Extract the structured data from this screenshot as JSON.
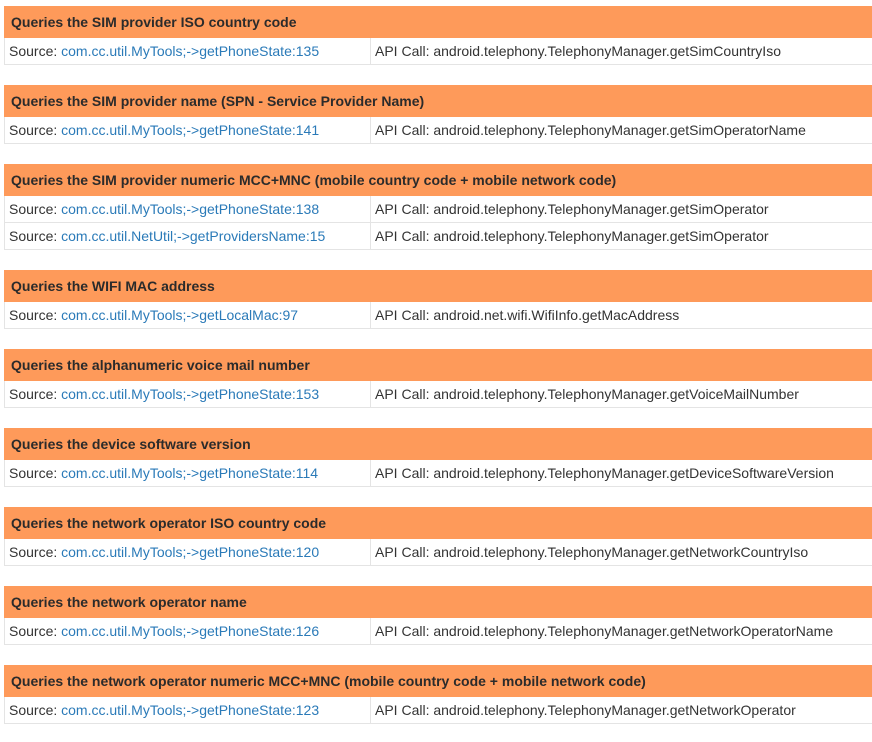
{
  "source_prefix": "Source: ",
  "api_prefix": "API Call: ",
  "sections": [
    {
      "title": "Queries the SIM provider ISO country code",
      "rows": [
        {
          "source": "com.cc.util.MyTools;->getPhoneState:135",
          "api": "android.telephony.TelephonyManager.getSimCountryIso"
        }
      ]
    },
    {
      "title": "Queries the SIM provider name (SPN - Service Provider Name)",
      "rows": [
        {
          "source": "com.cc.util.MyTools;->getPhoneState:141",
          "api": "android.telephony.TelephonyManager.getSimOperatorName"
        }
      ]
    },
    {
      "title": "Queries the SIM provider numeric MCC+MNC (mobile country code + mobile network code)",
      "rows": [
        {
          "source": "com.cc.util.MyTools;->getPhoneState:138",
          "api": "android.telephony.TelephonyManager.getSimOperator"
        },
        {
          "source": "com.cc.util.NetUtil;->getProvidersName:15",
          "api": "android.telephony.TelephonyManager.getSimOperator"
        }
      ]
    },
    {
      "title": "Queries the WIFI MAC address",
      "rows": [
        {
          "source": "com.cc.util.MyTools;->getLocalMac:97",
          "api": "android.net.wifi.WifiInfo.getMacAddress"
        }
      ]
    },
    {
      "title": "Queries the alphanumeric voice mail number",
      "rows": [
        {
          "source": "com.cc.util.MyTools;->getPhoneState:153",
          "api": "android.telephony.TelephonyManager.getVoiceMailNumber"
        }
      ]
    },
    {
      "title": "Queries the device software version",
      "rows": [
        {
          "source": "com.cc.util.MyTools;->getPhoneState:114",
          "api": "android.telephony.TelephonyManager.getDeviceSoftwareVersion"
        }
      ]
    },
    {
      "title": "Queries the network operator ISO country code",
      "rows": [
        {
          "source": "com.cc.util.MyTools;->getPhoneState:120",
          "api": "android.telephony.TelephonyManager.getNetworkCountryIso"
        }
      ]
    },
    {
      "title": "Queries the network operator name",
      "rows": [
        {
          "source": "com.cc.util.MyTools;->getPhoneState:126",
          "api": "android.telephony.TelephonyManager.getNetworkOperatorName"
        }
      ]
    },
    {
      "title": "Queries the network operator numeric MCC+MNC (mobile country code + mobile network code)",
      "rows": [
        {
          "source": "com.cc.util.MyTools;->getPhoneState:123",
          "api": "android.telephony.TelephonyManager.getNetworkOperator"
        }
      ]
    }
  ]
}
